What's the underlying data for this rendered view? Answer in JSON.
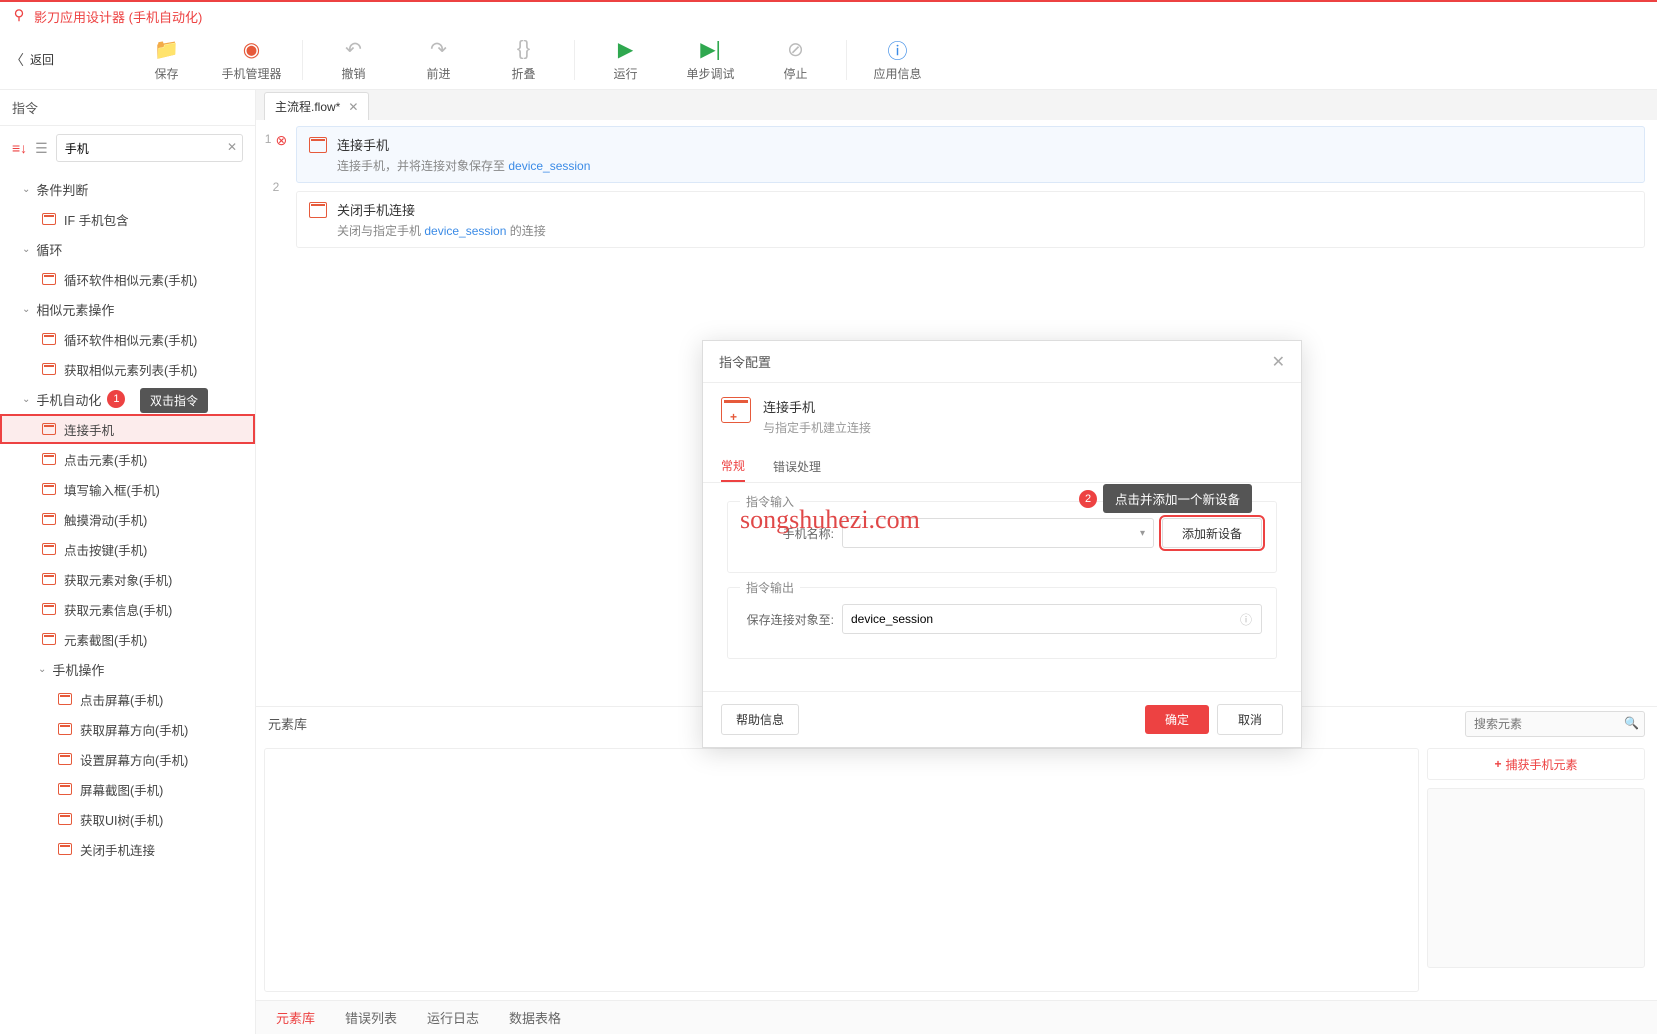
{
  "app": {
    "title": "影刀应用设计器 (手机自动化)"
  },
  "back_label": "返回",
  "toolbar": [
    {
      "label": "保存",
      "icon": "📁",
      "cls": "blue"
    },
    {
      "label": "手机管理器",
      "icon": "◉",
      "cls": "red",
      "sep_after": true
    },
    {
      "label": "撤销",
      "icon": "↶",
      "cls": "grey"
    },
    {
      "label": "前进",
      "icon": "↷",
      "cls": "grey"
    },
    {
      "label": "折叠",
      "icon": "{}",
      "cls": "grey",
      "sep_after": true
    },
    {
      "label": "运行",
      "icon": "▶",
      "cls": "green"
    },
    {
      "label": "单步调试",
      "icon": "▶|",
      "cls": "green"
    },
    {
      "label": "停止",
      "icon": "⊘",
      "cls": "grey",
      "sep_after": true
    },
    {
      "label": "应用信息",
      "icon": "ⓘ",
      "cls": "blue"
    }
  ],
  "sidebar": {
    "title": "指令",
    "search_value": "手机",
    "groups": [
      {
        "name": "条件判断",
        "items": [
          {
            "label": "IF 手机包含"
          }
        ]
      },
      {
        "name": "循环",
        "items": [
          {
            "label": "循环软件相似元素(手机)"
          }
        ]
      },
      {
        "name": "相似元素操作",
        "items": [
          {
            "label": "循环软件相似元素(手机)"
          },
          {
            "label": "获取相似元素列表(手机)"
          }
        ]
      },
      {
        "name": "手机自动化",
        "badge": "1",
        "tooltip": "双击指令",
        "items": [
          {
            "label": "连接手机",
            "highlighted": true
          },
          {
            "label": "点击元素(手机)"
          },
          {
            "label": "填写输入框(手机)"
          },
          {
            "label": "触摸滑动(手机)"
          },
          {
            "label": "点击按键(手机)"
          },
          {
            "label": "获取元素对象(手机)"
          },
          {
            "label": "获取元素信息(手机)"
          },
          {
            "label": "元素截图(手机)"
          }
        ]
      },
      {
        "name": "手机操作",
        "nested": true,
        "items": [
          {
            "label": "点击屏幕(手机)"
          },
          {
            "label": "获取屏幕方向(手机)"
          },
          {
            "label": "设置屏幕方向(手机)"
          },
          {
            "label": "屏幕截图(手机)"
          },
          {
            "label": "获取UI树(手机)"
          },
          {
            "label": "关闭手机连接"
          }
        ]
      }
    ]
  },
  "tab": {
    "label": "主流程.flow*"
  },
  "steps": [
    {
      "num": "1",
      "error": true,
      "title": "连接手机",
      "desc_pre": "连接手机，并将连接对象保存至 ",
      "desc_var": "device_session",
      "desc_post": ""
    },
    {
      "num": "2",
      "error": false,
      "title": "关闭手机连接",
      "desc_pre": "关闭与指定手机 ",
      "desc_var": "device_session",
      "desc_post": " 的连接"
    }
  ],
  "modal": {
    "title": "指令配置",
    "intro_title": "连接手机",
    "intro_desc": "与指定手机建立连接",
    "tabs": [
      "常规",
      "错误处理"
    ],
    "legend_input": "指令输入",
    "legend_output": "指令输出",
    "phone_label": "手机名称:",
    "add_device": "添加新设备",
    "save_label": "保存连接对象至:",
    "save_value": "device_session",
    "badge2": "2",
    "badge2_tip": "点击并添加一个新设备",
    "help": "帮助信息",
    "ok": "确定",
    "cancel": "取消"
  },
  "bottom": {
    "title": "元素库",
    "search_placeholder": "搜索元素",
    "capture": "捕获手机元素",
    "tabs": [
      "元素库",
      "错误列表",
      "运行日志",
      "数据表格"
    ]
  },
  "watermark": "songshuhezi.com"
}
